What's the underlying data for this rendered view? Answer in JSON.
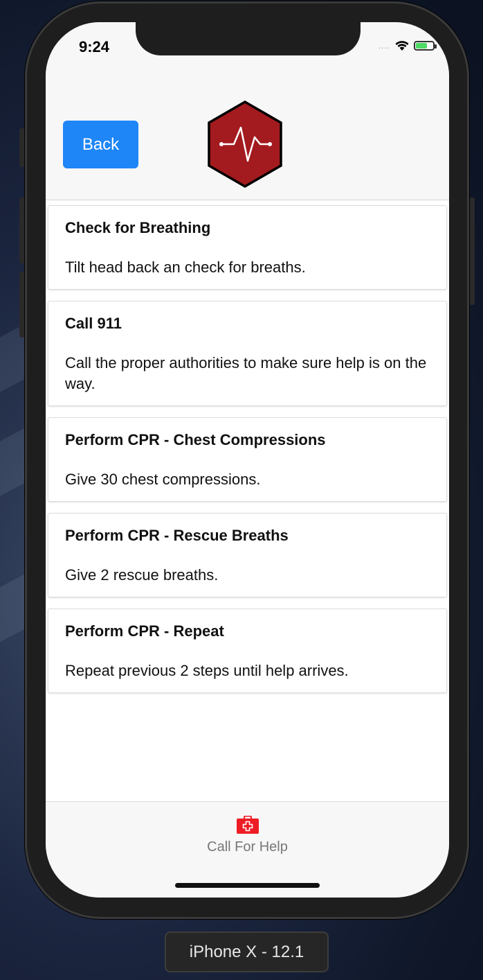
{
  "status_bar": {
    "time": "9:24",
    "signal": "....",
    "wifi_icon": "wifi-icon",
    "battery_icon": "battery-charging-icon"
  },
  "header": {
    "back_label": "Back",
    "logo_icon": "heartbeat-hexagon-icon"
  },
  "steps": [
    {
      "title": "Check for Breathing",
      "description": "Tilt head back an check for breaths."
    },
    {
      "title": "Call 911",
      "description": "Call the proper authorities to make sure help is on the way."
    },
    {
      "title": "Perform CPR - Chest Compressions",
      "description": "Give 30 chest compressions."
    },
    {
      "title": "Perform CPR - Rescue Breaths",
      "description": "Give 2 rescue breaths."
    },
    {
      "title": "Perform CPR - Repeat",
      "description": "Repeat previous 2 steps until help arrives."
    }
  ],
  "tab_bar": {
    "items": [
      {
        "label": "Call For Help",
        "icon": "first-aid-kit-icon"
      }
    ]
  },
  "device_label": "iPhone X - 12.1",
  "colors": {
    "accent_blue": "#1e86f7",
    "logo_red": "#a31b1f",
    "kit_red": "#ee1c25"
  }
}
